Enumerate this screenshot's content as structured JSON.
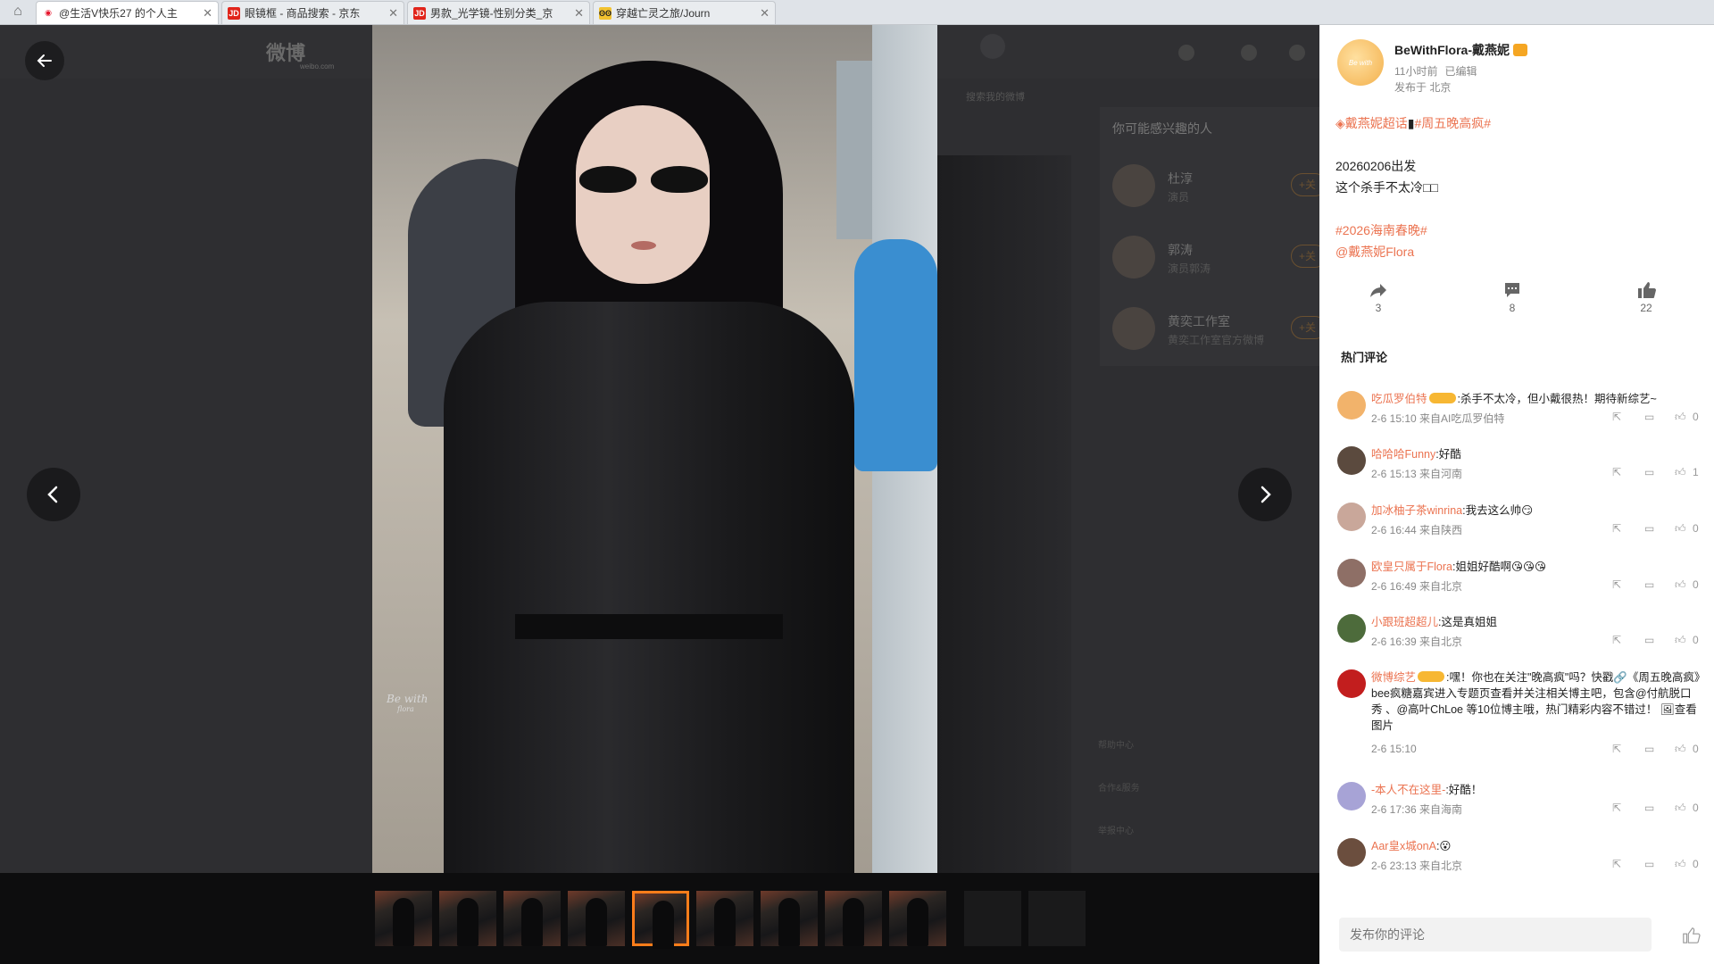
{
  "tabs": [
    {
      "title": "@生活V快乐27 的个人主",
      "icon": "weibo-icon",
      "active": true
    },
    {
      "title": "眼镜框 - 商品搜索 - 京东",
      "icon": "jd-icon",
      "active": false
    },
    {
      "title": "男款_光学镜-性别分类_京",
      "icon": "jd-icon",
      "active": false
    },
    {
      "title": "穿越亡灵之旅/Journ",
      "icon": "sunglasses-icon",
      "active": false
    }
  ],
  "background": {
    "logo": "微博",
    "logo_sub": "weibo.com",
    "search_placeholder": "搜索我的微博",
    "interest_title": "你可能感兴趣的人",
    "people": [
      {
        "name": "杜淳",
        "desc": "演员",
        "follow": "+关"
      },
      {
        "name": "郭涛",
        "desc": "演员郭涛",
        "follow": "+关"
      },
      {
        "name": "黄奕工作室",
        "desc": "黄奕工作室官方微博",
        "follow": "+关"
      }
    ],
    "footer": [
      "帮助中心",
      "合作&服务",
      "举报中心"
    ]
  },
  "photo": {
    "signature": "Be with",
    "signature_sub": "flora",
    "thumb_count": 9,
    "selected_index": 4
  },
  "post": {
    "author": "BeWithFlora-戴燕妮",
    "time": "11小时前",
    "edited": "已编辑",
    "location": "发布于 北京",
    "line1_tag1": "戴燕妮超话",
    "line1_tag2": "#周五晚高疯#",
    "line2": "20260206出发",
    "line3": "这个杀手不太冷□□",
    "tag3": "#2026海南春晚#",
    "mention": "@戴燕妮Flora",
    "reposts": "3",
    "comments": "8",
    "likes": "22",
    "hot_title": "热门评论"
  },
  "comments": [
    {
      "user": "吃瓜罗伯特",
      "text": ":杀手不太冷，但小戴很热！期待新综艺~",
      "meta": "2-6 15:10 来自AI吃瓜罗伯特",
      "likes": "0",
      "avatar": "#f2b36b",
      "vip": true
    },
    {
      "user": "哈哈哈Funny",
      "text": ":好酷",
      "meta": "2-6 15:13 来自河南",
      "likes": "1",
      "avatar": "#5b4a3e",
      "vip": false
    },
    {
      "user": "加冰柚子茶winrina",
      "text": ":我去这么帅😏",
      "meta": "2-6 16:44 来自陕西",
      "likes": "0",
      "avatar": "#c9a79a",
      "vip": false
    },
    {
      "user": "欧皇只属于Flora",
      "text": ":姐姐好酷啊😘😘😘",
      "meta": "2-6 16:49 来自北京",
      "likes": "0",
      "avatar": "#8e6f66",
      "vip": false
    },
    {
      "user": "小跟班超超儿",
      "text": ":这是真姐姐",
      "meta": "2-6 16:39 来自北京",
      "likes": "0",
      "avatar": "#4d6b3b",
      "vip": false
    },
    {
      "user": "微博综艺",
      "text": ":嘿！你也在关注\"晚高疯\"吗？快戳🔗《周五晚高疯》bee疯糖嘉宾进入专题页查看并关注相关博主吧，包含@付航脱口秀 、@高叶ChLoe 等10位博主哦，热门精彩内容不错过！ 🖼查看图片",
      "meta": "2-6 15:10",
      "likes": "0",
      "avatar": "#c21e1e",
      "vip": true
    },
    {
      "user": "-本人不在这里-",
      "text": ":好酷！",
      "meta": "2-6 17:36 来自海南",
      "likes": "0",
      "avatar": "#a7a3d6",
      "vip": false
    },
    {
      "user": "Aar皇x城onA",
      "text": ":😮",
      "meta": "2-6 23:13 来自北京",
      "likes": "0",
      "avatar": "#6b4e3e",
      "vip": false
    }
  ],
  "comment_input_placeholder": "发布你的评论",
  "colors": {
    "accent": "#eb7350",
    "selected_thumb": "#ff7d1a"
  }
}
